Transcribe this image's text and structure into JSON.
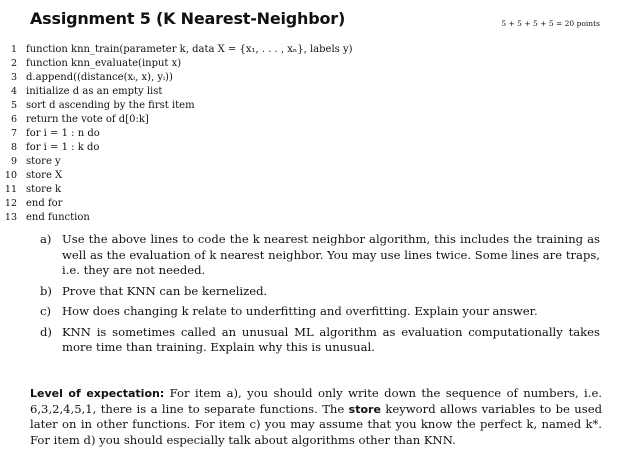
{
  "header": {
    "title": "Assignment 5 (K Nearest-Neighbor)",
    "points": "5 + 5 + 5 + 5 = 20 points"
  },
  "code_lines": [
    {
      "num": "1",
      "text": "function knn_train(parameter k, data X = {x₁, . . . , xₙ}, labels y)"
    },
    {
      "num": "2",
      "text": "function knn_evaluate(input x)"
    },
    {
      "num": "3",
      "text": "d.append((distance(xᵢ, x), yᵢ))"
    },
    {
      "num": "4",
      "text": "initialize d as an empty list"
    },
    {
      "num": "5",
      "text": "sort d ascending by the first item"
    },
    {
      "num": "6",
      "text": "return the vote of d[0:k]"
    },
    {
      "num": "7",
      "text": "for i = 1 : n do"
    },
    {
      "num": "8",
      "text": "for i = 1 : k do"
    },
    {
      "num": "9",
      "text": "store y"
    },
    {
      "num": "10",
      "text": "store X"
    },
    {
      "num": "11",
      "text": "store k"
    },
    {
      "num": "12",
      "text": "end for"
    },
    {
      "num": "13",
      "text": "end function"
    }
  ],
  "questions": [
    {
      "label": "a)",
      "text": "Use the above lines to code the k nearest neighbor algorithm, this includes the training as well as the evaluation of k nearest neighbor. You may use lines twice. Some lines are traps, i.e. they are not needed."
    },
    {
      "label": "b)",
      "text": "Prove that KNN can be kernelized."
    },
    {
      "label": "c)",
      "text": "How does changing k relate to underfitting and overfitting. Explain your answer."
    },
    {
      "label": "d)",
      "text": "KNN is sometimes called an unusual ML algorithm as evaluation computationally takes more time than training. Explain why this is unusual."
    }
  ],
  "expectation": {
    "heading": "Level of expectation:",
    "text_part1": " For item a), you should only write down the sequence of numbers, i.e. 6,3,2,4,5,1, there is a line to separate functions. The ",
    "keyword": "store",
    "text_part2": " keyword allows variables to be used later on in other functions. For item c) you may assume that you know the perfect k, named k*. For item d) you should especially talk about algorithms other than KNN."
  }
}
